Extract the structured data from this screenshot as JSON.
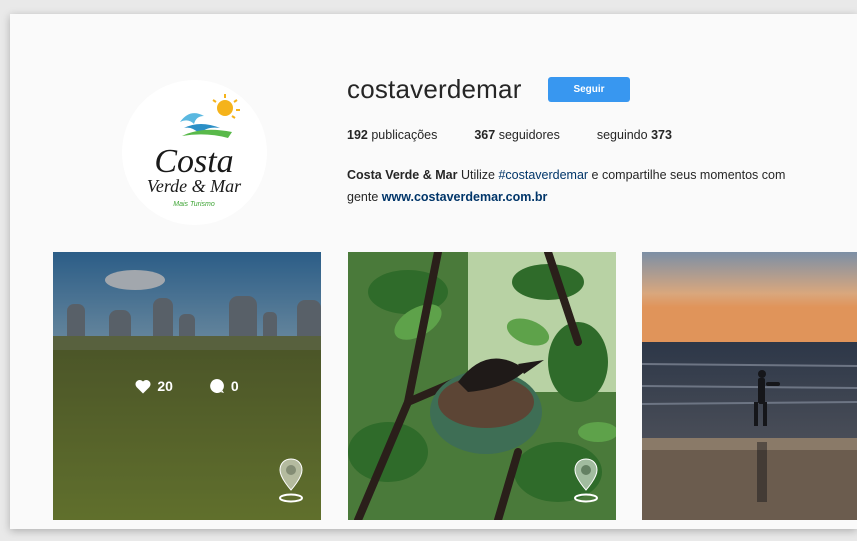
{
  "profile": {
    "username": "costaverdemar",
    "follow_label": "Seguir",
    "logo": {
      "line1": "Costa",
      "line2": "Verde & Mar",
      "tagline": "Mais Turismo"
    },
    "stats": {
      "posts_count": "192",
      "posts_label": " publicações",
      "followers_count": "367",
      "followers_label": " seguidores",
      "following_label": "seguindo ",
      "following_count": "373"
    },
    "bio": {
      "name": "Costa Verde & Mar",
      "text1": " Utilize ",
      "hashtag": "#costaverdemar",
      "text2": " e compartilhe seus momentos com",
      "text3": "gente ",
      "website": "www.costaverdemar.com.br"
    }
  },
  "posts": [
    {
      "likes": "20",
      "comments": "0",
      "hover": true
    },
    {
      "hover": false
    },
    {
      "hover": false
    }
  ],
  "colors": {
    "follow_button": "#3897f0",
    "link": "#003569"
  },
  "icons": [
    "heart-icon",
    "comment-icon",
    "location-pin-icon"
  ]
}
